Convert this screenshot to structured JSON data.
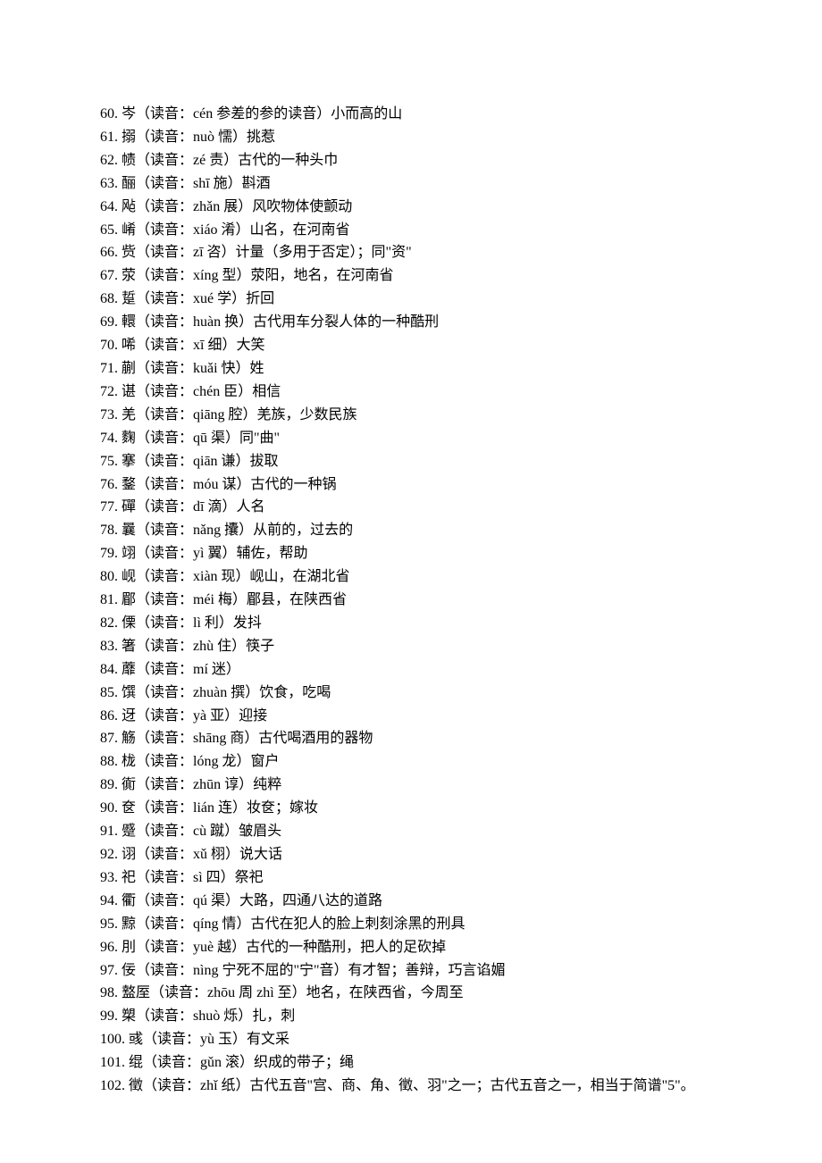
{
  "entries": [
    {
      "num": "60.",
      "text": "岑（读音：cén 参差的参的读音）小而高的山"
    },
    {
      "num": "61.",
      "text": "搦（读音：nuò 懦）挑惹"
    },
    {
      "num": "62.",
      "text": "帻（读音：zé 责）古代的一种头巾"
    },
    {
      "num": "63.",
      "text": "酾（读音：shī 施）斟酒"
    },
    {
      "num": "64.",
      "text": "飐（读音：zhǎn 展）风吹物体使颤动"
    },
    {
      "num": "65.",
      "text": "崤（读音：xiáo 淆）山名，在河南省"
    },
    {
      "num": "66.",
      "text": "赀（读音：zī 咨）计量（多用于否定）；同\"资\""
    },
    {
      "num": "67.",
      "text": "荥（读音：xíng 型）荥阳，地名，在河南省"
    },
    {
      "num": "68.",
      "text": "踅（读音：xué 学）折回"
    },
    {
      "num": "69.",
      "text": "轘（读音：huàn 换）古代用车分裂人体的一种酷刑"
    },
    {
      "num": "70.",
      "text": "唏（读音：xī 细）大笑"
    },
    {
      "num": "71.",
      "text": "蒯（读音：kuǎi 快）姓"
    },
    {
      "num": "72.",
      "text": "谌（读音：chén 臣）相信"
    },
    {
      "num": "73.",
      "text": "羌（读音：qiāng 腔）羌族，少数民族"
    },
    {
      "num": "74.",
      "text": "麴（读音：qū 渠）同\"曲\""
    },
    {
      "num": "75.",
      "text": "搴（读音：qiān 谦）拔取"
    },
    {
      "num": "76.",
      "text": "鍪（读音：móu 谋）古代的一种锅"
    },
    {
      "num": "77.",
      "text": "磾（读音：dī 滴）人名"
    },
    {
      "num": "78.",
      "text": "曩（读音：nǎng 攮）从前的，过去的"
    },
    {
      "num": "79.",
      "text": "翊（读音：yì 翼）辅佐，帮助"
    },
    {
      "num": "80.",
      "text": "岘（读音：xiàn 现）岘山，在湖北省"
    },
    {
      "num": "81.",
      "text": "郿（读音：méi 梅）郿县，在陕西省"
    },
    {
      "num": "82.",
      "text": "傈（读音：lì 利）发抖"
    },
    {
      "num": "83.",
      "text": "箸（读音：zhù 住）筷子"
    },
    {
      "num": "84.",
      "text": "蘼（读音：mí 迷）"
    },
    {
      "num": "85.",
      "text": "馔（读音：zhuàn 撰）饮食，吃喝"
    },
    {
      "num": "86.",
      "text": "迓（读音：yà 亚）迎接"
    },
    {
      "num": "87.",
      "text": "觞（读音：shāng 商）古代喝酒用的器物"
    },
    {
      "num": "88.",
      "text": "栊（读音：lóng 龙）窗户"
    },
    {
      "num": "89.",
      "text": "衠（读音：zhūn 谆）纯粹"
    },
    {
      "num": "90.",
      "text": "奁（读音：lián 连）妆奁；嫁妆"
    },
    {
      "num": "91.",
      "text": "蹙（读音：cù 蹴）皱眉头"
    },
    {
      "num": "92.",
      "text": "诩（读音：xǔ 栩）说大话"
    },
    {
      "num": "93.",
      "text": "祀（读音：sì 四）祭祀"
    },
    {
      "num": "94.",
      "text": "衢（读音：qú 渠）大路，四通八达的道路"
    },
    {
      "num": "95.",
      "text": "黥（读音：qíng 情）古代在犯人的脸上刺刻涂黑的刑具"
    },
    {
      "num": "96.",
      "text": "刖（读音：yuè 越）古代的一种酷刑，把人的足砍掉"
    },
    {
      "num": "97.",
      "text": "佞（读音：nìng 宁死不屈的\"宁\"音）有才智；善辩，巧言谄媚"
    },
    {
      "num": "98.",
      "text": "盩厔（读音：zhōu 周 zhì 至）地名，在陕西省，今周至"
    },
    {
      "num": "99.",
      "text": "槊（读音：shuò 烁）扎，刺"
    },
    {
      "num": "100.",
      "text": " 彧（读音：yù 玉）有文采"
    },
    {
      "num": "101.",
      "text": " 绲（读音：gǔn 滚）织成的带子；绳"
    }
  ],
  "entry102": {
    "num": "102.",
    "text": "徵（读音：zhǐ 纸）古代五音\"宫、商、角、徵、羽\"之一；古代五音之一，相当于简谱\"5\"。"
  }
}
